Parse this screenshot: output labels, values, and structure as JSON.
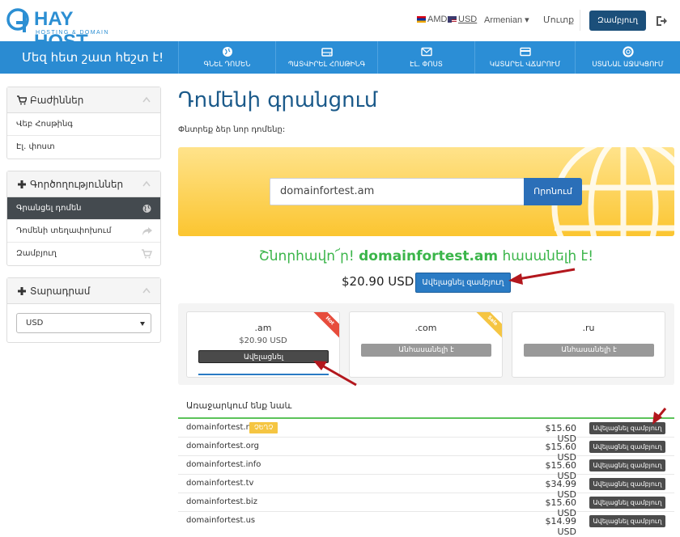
{
  "brand": {
    "name": "HAY HOST",
    "subtitle": "HOSTING & DOMAIN",
    "accent": "#2c8fd3"
  },
  "topbar": {
    "currency_amd": "AMD",
    "currency_usd": "USD",
    "language": "Armenian ▾",
    "login": "Մուտք",
    "cart_button": "Զամբյուղ",
    "logout_icon": "logout-icon"
  },
  "navbar": {
    "tagline": "Մեզ հետ շատ հեշտ է!",
    "items": [
      {
        "label": "ԳՆԵԼ ԴՈՄԵՆ",
        "icon": "globe-icon"
      },
      {
        "label": "ՊԱՏՎԻՐԵԼ ՀՈՍԹԻՆԳ",
        "icon": "server-icon"
      },
      {
        "label": "ԷԼ. ՓՈՍՏ",
        "icon": "envelope-icon"
      },
      {
        "label": "ԿԱՏԱՐԵԼ ՎՃԱՐՈՒՄ",
        "icon": "credit-card-icon"
      },
      {
        "label": "ՍՏԱՆԱԼ ԱՋԱԿՑՈՒՄ",
        "icon": "support-icon"
      }
    ]
  },
  "sidebar": {
    "sections": {
      "title": "Բաժիններ",
      "items": [
        "Վեբ Հոսթինգ",
        "Էլ. փոստ"
      ]
    },
    "actions": {
      "title": "Գործողություններ",
      "items": [
        "Գրանցել դոմեն",
        "Դոմենի տեղափոխում",
        "Զամբյուղ"
      ]
    },
    "currency": {
      "title": "Տարադրամ",
      "selected": "USD"
    }
  },
  "main": {
    "title": "Դոմենի գրանցում",
    "subtitle": "Փնտրեք ձեր նոր դոմենը:",
    "search_value": "domainfortest.am",
    "search_button": "Որոնում",
    "available_prefix": "Շնորհավո՜ր!",
    "available_domain": "domainfortest.am",
    "available_suffix": "հասանելի է!",
    "price": "$20.90 USD",
    "add_to_cart": "Ավելացնել զամբյուղ",
    "tlds": [
      {
        "name": ".am",
        "price": "$20.90 USD",
        "button": "Ավելացնել",
        "ribbon": "Hot",
        "ribbon_color": "#e74c3c"
      },
      {
        "name": ".com",
        "price": "",
        "button": "Անհասանելի է",
        "ribbon": "Sale",
        "ribbon_color": "#f5c542"
      },
      {
        "name": ".ru",
        "price": "",
        "button": "Անհասանելի է",
        "ribbon": "",
        "ribbon_color": ""
      }
    ],
    "suggest_title": "Առաջարկում ենք նաև",
    "suggestions": [
      {
        "domain": "domainfortest.net",
        "tag": "ՉԵՂՉ",
        "price": "$15.60 USD",
        "button": "Ավելացնել զամբյուղ"
      },
      {
        "domain": "domainfortest.org",
        "tag": "",
        "price": "$15.60 USD",
        "button": "Ավելացնել զամբյուղ"
      },
      {
        "domain": "domainfortest.info",
        "tag": "",
        "price": "$15.60 USD",
        "button": "Ավելացնել զամբյուղ"
      },
      {
        "domain": "domainfortest.tv",
        "tag": "",
        "price": "$34.99 USD",
        "button": "Ավելացնել զամբյուղ"
      },
      {
        "domain": "domainfortest.biz",
        "tag": "",
        "price": "$15.60 USD",
        "button": "Ավելացնել զամբյուղ"
      },
      {
        "domain": "domainfortest.us",
        "tag": "",
        "price": "$14.99 USD",
        "button": "Ավելացնել զամբյուղ"
      }
    ]
  }
}
